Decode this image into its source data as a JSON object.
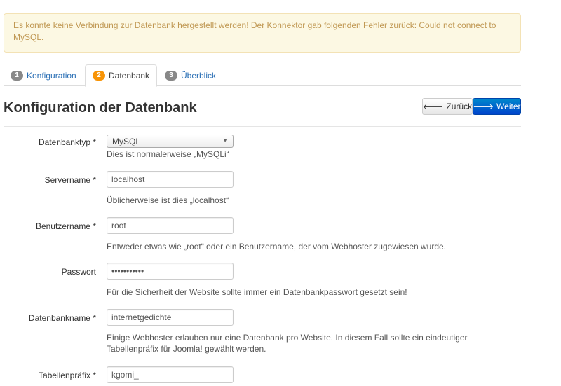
{
  "alert": {
    "message": "Es konnte keine Verbindung zur Datenbank hergestellt werden! Der Konnektor gab folgenden Fehler zurück: Could not connect to MySQL."
  },
  "tabs": [
    {
      "number": "1",
      "label": "Konfiguration"
    },
    {
      "number": "2",
      "label": "Datenbank"
    },
    {
      "number": "3",
      "label": "Überblick"
    }
  ],
  "page": {
    "title": "Konfiguration der Datenbank"
  },
  "buttons": {
    "back_label": "Zurück",
    "next_label": "Weiter"
  },
  "form": {
    "db_type": {
      "label": "Datenbanktyp *",
      "value": "MySQL",
      "help": "Dies ist normalerweise „MySQLi“"
    },
    "server": {
      "label": "Servername *",
      "value": "localhost",
      "help": "Üblicherweise ist dies „localhost“"
    },
    "username": {
      "label": "Benutzername *",
      "value": "root",
      "help": "Entweder etwas wie „root“ oder ein Benutzername, der vom Webhoster zugewiesen wurde."
    },
    "password": {
      "label": "Passwort",
      "value": "•••••••••••",
      "help": "Für die Sicherheit der Website sollte immer ein Datenbankpasswort gesetzt sein!"
    },
    "db_name": {
      "label": "Datenbankname *",
      "value": "internetgedichte",
      "help": "Einige Webhoster erlauben nur eine Datenbank pro Website. In diesem Fall sollte ein eindeutiger Tabellenpräfix für Joomla! gewählt werden."
    },
    "prefix": {
      "label": "Tabellenpräfix *",
      "value": "kgomi_"
    }
  },
  "colors": {
    "alert_bg": "#fcf8e3",
    "alert_text": "#c09853",
    "link": "#2a6fb5",
    "primary": "#0055cc",
    "active_badge": "#f89406"
  }
}
